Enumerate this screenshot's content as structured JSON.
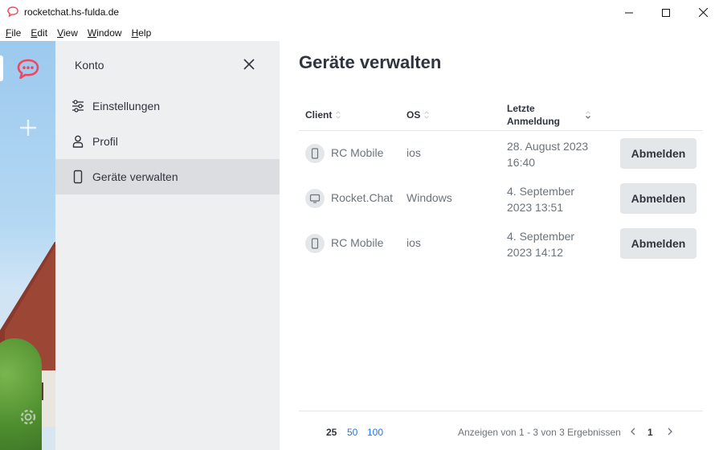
{
  "window": {
    "title": "rocketchat.hs-fulda.de",
    "menu": [
      {
        "mnemonic": "F",
        "rest": "ile"
      },
      {
        "mnemonic": "E",
        "rest": "dit"
      },
      {
        "mnemonic": "V",
        "rest": "iew"
      },
      {
        "mnemonic": "W",
        "rest": "indow"
      },
      {
        "mnemonic": "H",
        "rest": "elp"
      }
    ]
  },
  "colors": {
    "brand_red": "#f5455c",
    "link_blue": "#1d74f5",
    "sidebar_bg": "#eeeff1",
    "active_bg": "#dcdde1",
    "button_bg": "#e4e7ea"
  },
  "rail": {
    "server_icon": "rocketchat-logo-icon",
    "add_icon": "plus-icon"
  },
  "sidebar": {
    "title": "Konto",
    "items": [
      {
        "label": "Einstellungen",
        "icon": "sliders-icon",
        "active": false
      },
      {
        "label": "Profil",
        "icon": "user-icon",
        "active": false
      },
      {
        "label": "Geräte verwalten",
        "icon": "mobile-icon",
        "active": true
      }
    ]
  },
  "main": {
    "title": "Geräte verwalten",
    "columns": {
      "client": "Client",
      "os": "OS",
      "login_line1": "Letzte",
      "login_line2": "Anmeldung"
    },
    "rows": [
      {
        "icon": "mobile-icon",
        "client": "RC Mobile",
        "os": "ios",
        "login_date": "28. August 2023",
        "login_time": "16:40",
        "action": "Abmelden"
      },
      {
        "icon": "desktop-icon",
        "client": "Rocket.Chat",
        "os": "Windows",
        "login_date": "4. September",
        "login_time": "2023 13:51",
        "action": "Abmelden"
      },
      {
        "icon": "mobile-icon",
        "client": "RC Mobile",
        "os": "ios",
        "login_date": "4. September",
        "login_time": "2023 14:12",
        "action": "Abmelden"
      }
    ],
    "pagination": {
      "per_page_options": [
        "25",
        "50",
        "100"
      ],
      "range_text": "Anzeigen von 1 - 3 von 3 Ergebnissen",
      "current_page": "1"
    }
  }
}
